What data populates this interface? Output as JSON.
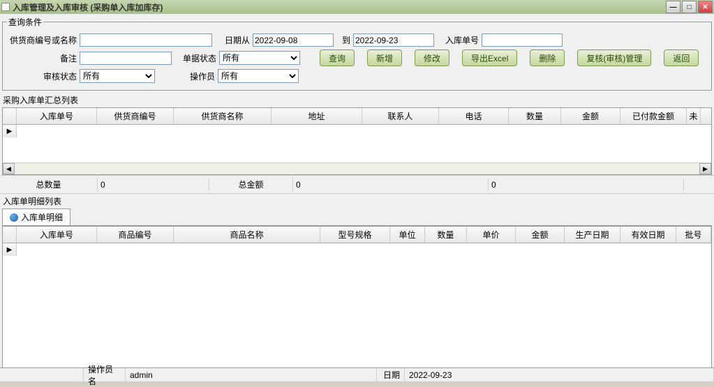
{
  "window": {
    "title": "入库管理及入库审核 (采购单入库加库存)"
  },
  "search": {
    "legend": "查询条件",
    "supplier_label": "供货商编号或名称",
    "supplier_value": "",
    "date_from_label": "日期从",
    "date_from_value": "2022-09-08",
    "date_to_label": "到",
    "date_to_value": "2022-09-23",
    "receipt_no_label": "入库单号",
    "receipt_no_value": "",
    "remark_label": "备注",
    "remark_value": "",
    "bill_status_label": "单据状态",
    "bill_status_value": "所有",
    "audit_status_label": "审核状态",
    "audit_status_value": "所有",
    "operator_label": "操作员",
    "operator_value": "所有"
  },
  "buttons": {
    "query": "查询",
    "add": "新增",
    "modify": "修改",
    "export": "导出Excel",
    "delete": "删除",
    "audit": "复核(审核)管理",
    "back": "返回"
  },
  "summary_grid": {
    "title": "采购入库单汇总列表",
    "columns": [
      "入库单号",
      "供货商编号",
      "供货商名称",
      "地址",
      "联系人",
      "电话",
      "数量",
      "金额",
      "已付款金额",
      "未"
    ]
  },
  "totals": {
    "qty_label": "总数量",
    "qty_value": "0",
    "amt_label": "总金额",
    "amt_value": "0",
    "blank_value": "0"
  },
  "detail_grid": {
    "title": "入库单明细列表",
    "tab_label": "入库单明细",
    "columns": [
      "入库单号",
      "商品编号",
      "商品名称",
      "型号规格",
      "单位",
      "数量",
      "单价",
      "金额",
      "生产日期",
      "有效日期",
      "批号"
    ]
  },
  "statusbar": {
    "operator_label": "操作员名",
    "operator_value": "admin",
    "date_label": "日期",
    "date_value": "2022-09-23"
  }
}
